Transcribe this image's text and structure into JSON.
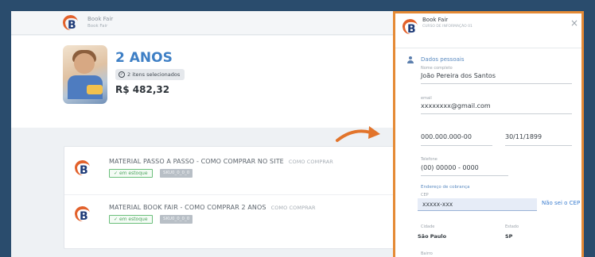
{
  "brand": {
    "name": "Book Fair",
    "subtitle": "Book Fair"
  },
  "summary": {
    "age_title": "2 ANOS",
    "items_selected": "2 itens selecionados",
    "price": "R$ 482,32"
  },
  "items": [
    {
      "title": "MATERIAL PASSO A PASSO - COMO COMPRAR NO SITE",
      "how": "COMO COMPRAR",
      "stock": "em estoque",
      "code": "SKU0_0_0_0"
    },
    {
      "title": "MATERIAL BOOK FAIR - COMO COMPRAR 2 ANOS",
      "how": "COMO COMPRAR",
      "stock": "em estoque",
      "code": "SKU0_0_0_0"
    }
  ],
  "panel": {
    "brand": "Book Fair",
    "brand_sub": "CURSO DE INFORMAÇÃO 01",
    "close": "×",
    "section_personal": "Dados pessoais",
    "name_label": "Nome completo",
    "name_value": "João Pereira dos Santos",
    "email_label": "email",
    "email_value": "xxxxxxxx@gmail.com",
    "cpf_value": "000.000.000-00",
    "birth_value": "30/11/1899",
    "phone_label": "Telefone",
    "phone_value": "(00) 00000 - 0000",
    "section_billing": "Endereço de cobrança",
    "cep_label": "CEP",
    "cep_value": "xxxxx-xxx",
    "cep_link": "Não sei o CEP",
    "city_label": "Cidade",
    "city_value": "São Paulo",
    "state_label": "Estado",
    "state_value": "SP",
    "district_label": "Bairro"
  },
  "colors": {
    "accent": "#e58a35",
    "brand_blue": "#3e7fc5",
    "frame": "#2a4c6d"
  }
}
